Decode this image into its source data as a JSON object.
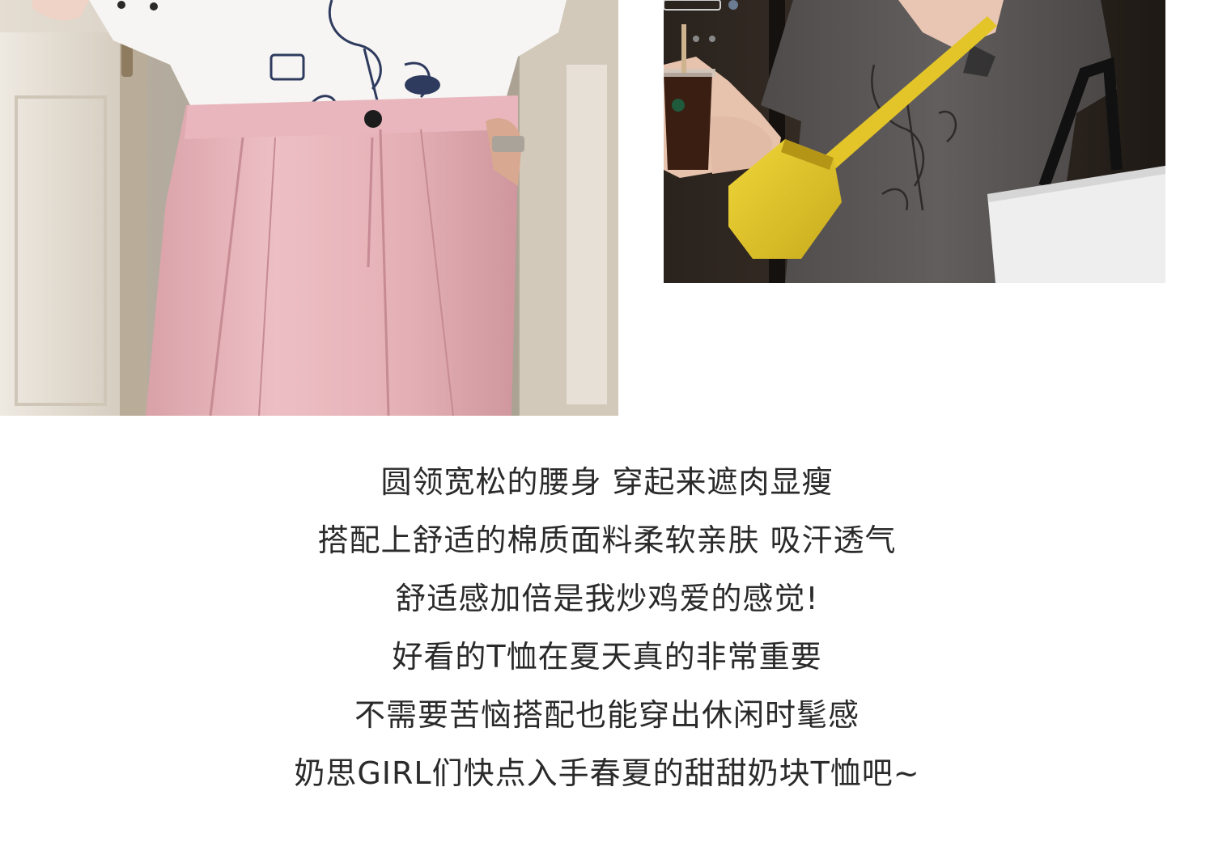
{
  "caption": {
    "lines": [
      "圆领宽松的腰身 穿起来遮肉显瘦",
      "搭配上舒适的棉质面料柔软亲肤 吸汗透气",
      "舒适感加倍是我炒鸡爱的感觉!",
      "好看的T恤在夏天真的非常重要",
      "不需要苦恼搭配也能穿出休闲时髦感",
      "奶思GIRL们快点入手春夏的甜甜奶块T恤吧~"
    ]
  },
  "colors": {
    "text": "#2a2a2a",
    "pink_pants": "#e9b7bd",
    "gray_tshirt": "#5e5a5a",
    "yellow_bag": "#e2c62a",
    "white_tshirt": "#f6f5f3"
  }
}
